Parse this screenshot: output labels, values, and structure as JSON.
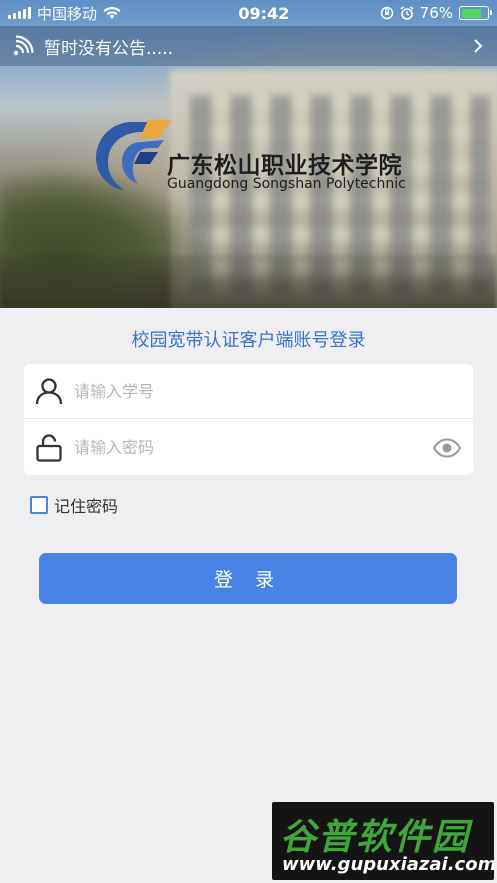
{
  "status_bar": {
    "carrier": "中国移动",
    "time": "09:42",
    "battery": "76%",
    "battery_level": 0.76,
    "icons": [
      "signal-icon",
      "wifi-icon",
      "orientation-lock-icon",
      "alarm-icon",
      "battery-icon"
    ]
  },
  "notice": {
    "text": "暂时没有公告.....",
    "icon": "speaker-icon",
    "chevron": "chevron-right-icon"
  },
  "logo": {
    "name_cn": "广东松山职业技术学院",
    "name_en": "Guangdong Songshan Polytechnic"
  },
  "login": {
    "title": "校园宽带认证客户端账号登录",
    "username_placeholder": "请输入学号",
    "password_placeholder": "请输入密码",
    "remember_label": "记住密码",
    "submit_label": "登 录"
  },
  "watermark": {
    "name": "谷普软件园",
    "url": "www.gupuxiazai.com"
  },
  "colors": {
    "accent": "#4a83e6",
    "title": "#3a72c8",
    "background": "#efeff1",
    "battery": "#4cd964"
  }
}
